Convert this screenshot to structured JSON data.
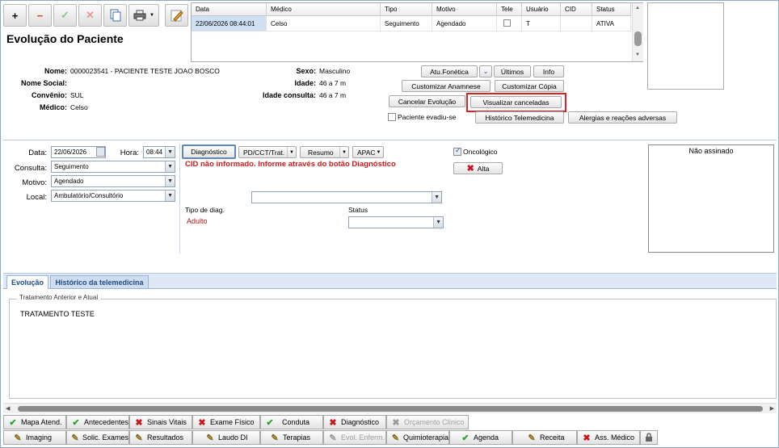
{
  "toolbar": {
    "add_label": "+",
    "remove_label": "−",
    "confirm_label": "✓",
    "cancel_label": "✕"
  },
  "page_title": "Evolução do Paciente",
  "grid": {
    "headers": [
      "Data",
      "Médico",
      "Tipo",
      "Motivo",
      "Tele",
      "Usuário",
      "CID",
      "Status"
    ],
    "row": [
      "22/06/2026 08:44:01",
      "Celso",
      "Seguimento",
      "Agendado",
      "",
      "T",
      "",
      "ATIVA"
    ]
  },
  "patient": {
    "nome_label": "Nome:",
    "nome": "0000023541 - PACIENTE TESTE JOAO BOSCO",
    "nome_social_label": "Nome Social:",
    "convenio_label": "Convênio:",
    "convenio": "SUL",
    "medico_label": "Médico:",
    "medico": "Celso",
    "sexo_label": "Sexo:",
    "sexo": "Masculino",
    "idade_label": "Idade:",
    "idade": "46 a 7 m",
    "idade_consulta_label": "Idade consulta:",
    "idade_consulta": "46 a 7 m"
  },
  "actions": {
    "atu_fonetica": "Atu.Fonética",
    "ultimos": "Últimos",
    "info": "Info",
    "customizar_anamnese": "Customizar Anamnese",
    "customizar_copia": "Customizar Cópia",
    "cancelar_evolucao": "Cancelar Evolução",
    "visualizar_canceladas": "Visualizar canceladas",
    "paciente_evadiu": "Paciente evadiu-se",
    "historico_telemedicina": "Histórico Telemedicina",
    "alergias": "Alergias e reações adversas"
  },
  "form": {
    "data_label": "Data:",
    "data": "22/06/2026",
    "hora_label": "Hora:",
    "hora": "08:44",
    "consulta_label": "Consulta:",
    "consulta": "Seguimento",
    "motivo_label": "Motivo:",
    "motivo": "Agendado",
    "local_label": "Local:",
    "local": "Ambulatório/Consultório"
  },
  "diag": {
    "diagnostico": "Diagnóstico",
    "pd": "PD/CCT/Trat.",
    "resumo": "Resumo",
    "apac": "APAC",
    "cid_warning": "CID não informado. Informe através do botão Diagnóstico",
    "tipo_label": "Tipo de diag.",
    "status_label": "Status",
    "adulto": "Adulto",
    "oncologico": "Oncológico",
    "alta": "Alta"
  },
  "signature": {
    "status": "Não assinado"
  },
  "tabs": {
    "evolucao": "Evolução",
    "historico": "Histórico da telemedicina"
  },
  "text_area": {
    "legend": "Tratamento Anterior e Atual",
    "content": "TRATAMENTO TESTE"
  },
  "bottom_row1": [
    "Mapa Atend.",
    "Antecedentes",
    "Sinais Vitais",
    "Exame Físico",
    "Conduta",
    "Diagnóstico",
    "Orçamento Clínico"
  ],
  "bottom_row2": [
    "Imaging",
    "Solic. Exames",
    "Resultados",
    "Laudo DI",
    "Terapias",
    "Evol. Enferm.",
    "Quimioterapia",
    "Agenda",
    "Receita",
    "Ass. Médico"
  ],
  "colors": {
    "accent": "#c8171c",
    "tab_blue": "#1f4a8a",
    "highlight": "#e02020"
  }
}
